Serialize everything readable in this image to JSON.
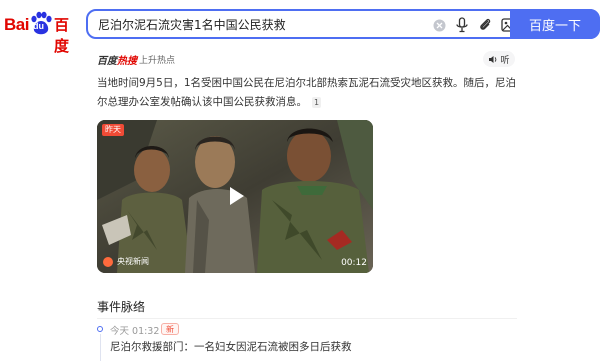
{
  "logo": {
    "latin": "Bai",
    "du": "du",
    "chinese": "百度"
  },
  "search": {
    "query": "尼泊尔泥石流灾害1名中国公民获救",
    "button_label": "百度一下"
  },
  "hot": {
    "brand_prefix": "百度",
    "brand_suffix": "热搜",
    "subtitle": "上升热点",
    "listen_label": "听"
  },
  "summary": {
    "text": "当地时间9月5日，1名受困中国公民在尼泊尔北部热索瓦泥石流受灾地区获救。随后，尼泊尔总理办公室发帖确认该中国公民获救消息。",
    "citation": "1"
  },
  "video": {
    "badge": "昨天",
    "source": "央视新闻",
    "duration": "00:12"
  },
  "timeline": {
    "title": "事件脉络",
    "items": [
      {
        "time": "今天 01:32",
        "tag": "新",
        "text": "尼泊尔救援部门：一名妇女因泥石流被困多日后获救"
      }
    ]
  },
  "colors": {
    "brand_red": "#e10601",
    "accent_blue": "#4e6ef2",
    "badge_red": "#f04b36"
  }
}
